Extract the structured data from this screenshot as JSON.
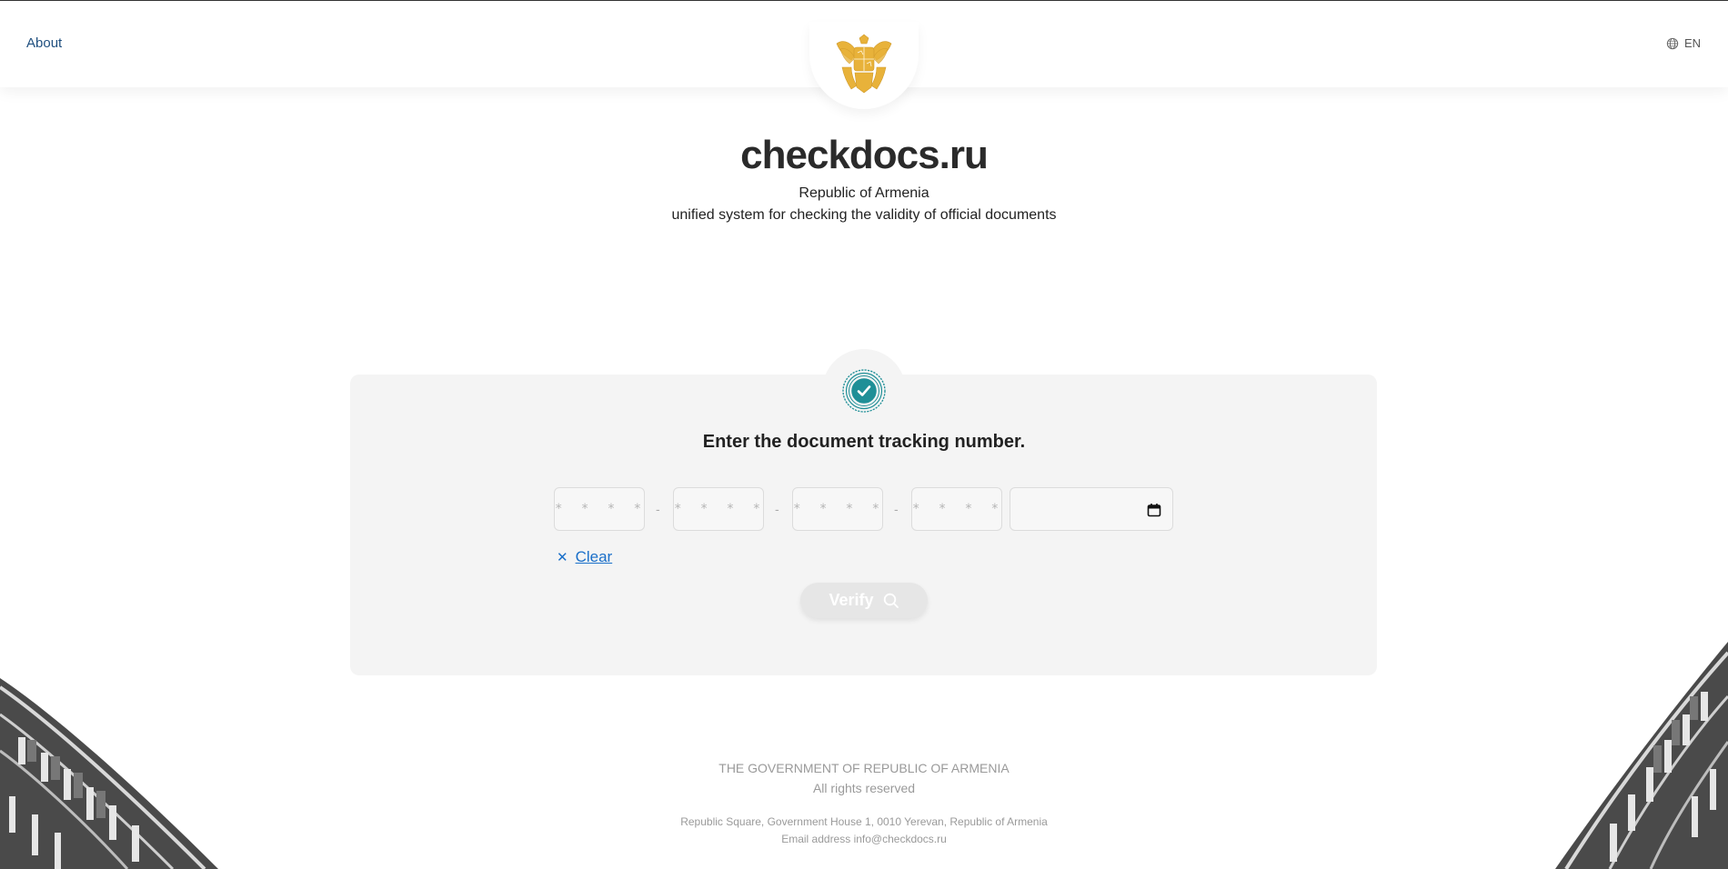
{
  "header": {
    "about_label": "About",
    "language_label": "EN"
  },
  "hero": {
    "title": "checkdocs.ru",
    "subtitle_line1": "Republic of Armenia",
    "subtitle_line2": "unified system for checking the validity of official documents"
  },
  "form": {
    "heading": "Enter the document tracking number.",
    "segment_placeholder": "* * * *",
    "separator": "-",
    "segments": [
      "",
      "",
      "",
      ""
    ],
    "date_value": "",
    "clear_label": "Clear",
    "verify_label": "Verify"
  },
  "footer": {
    "government": "THE GOVERNMENT OF REPUBLIC OF ARMENIA",
    "rights": "All rights reserved",
    "address": "Republic Square, Government House 1, 0010 Yerevan, Republic of Armenia",
    "email": "Email address info@checkdocs.ru"
  },
  "colors": {
    "accent_link": "#1a6fc9",
    "about_link": "#1f4f7f",
    "badge_teal": "#1f8f97",
    "emblem_gold": "#e8b23a",
    "card_bg": "#f4f4f4"
  },
  "icons": {
    "emblem": "armenia-coat-of-arms-icon",
    "language": "globe-icon",
    "badge": "verified-seal-icon",
    "calendar": "calendar-icon",
    "clear": "close-icon",
    "verify": "search-icon"
  }
}
